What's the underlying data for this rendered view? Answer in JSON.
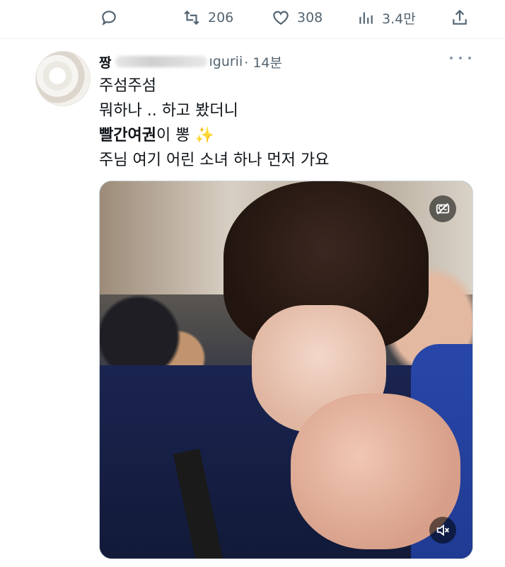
{
  "actions": {
    "reply_count": "",
    "retweet_count": "206",
    "like_count": "308",
    "views_count": "3.4만"
  },
  "tweet": {
    "name_prefix": "짱",
    "handle_suffix": "ıgurii",
    "time": "· 14분",
    "lines": [
      "주섬주섬",
      "뭐하나 .. 하고 봤더니",
      "빨간여권",
      "이 뽕 ",
      "✨",
      "주님 여기 어린 소녀 하나 먼저 가요"
    ]
  },
  "media": {
    "cc_label": "CC"
  },
  "icons": {
    "reply": "reply-icon",
    "retweet": "retweet-icon",
    "like": "heart-icon",
    "views": "views-icon",
    "share": "share-icon",
    "more": "more-icon",
    "captions": "captions-off-icon",
    "mute": "mute-icon"
  }
}
